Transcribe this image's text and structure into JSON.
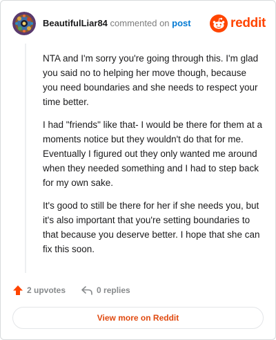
{
  "header": {
    "username": "BeautifulLiar84",
    "action_text": "commented on",
    "post_link": "post",
    "logo_text": "reddit",
    "avatar_icon": "user-avatar-icon"
  },
  "comment": {
    "paragraphs": [
      "NTA and I'm sorry you're going through this. I'm glad you said no to helping her move though, because you need boundaries and she needs to respect your time better.",
      "I had \"friends\" like that- I would be there for them at a moments notice but they wouldn't do that for me. Eventually I figured out they only wanted me around when they needed something and I had to step back for my own sake.",
      "It's good to still be there for her if she needs you, but it's also important that you're setting boundaries to that because you deserve better. I hope that she can fix this soon."
    ]
  },
  "actions": {
    "upvotes": "2 upvotes",
    "replies": "0 replies",
    "upvote_icon": "upvote-arrow-icon",
    "reply_icon": "reply-arrow-icon"
  },
  "footer": {
    "view_more": "View more on Reddit"
  },
  "colors": {
    "brand": "#ff4500",
    "link": "#0079d3",
    "view_more": "#e0490f"
  }
}
